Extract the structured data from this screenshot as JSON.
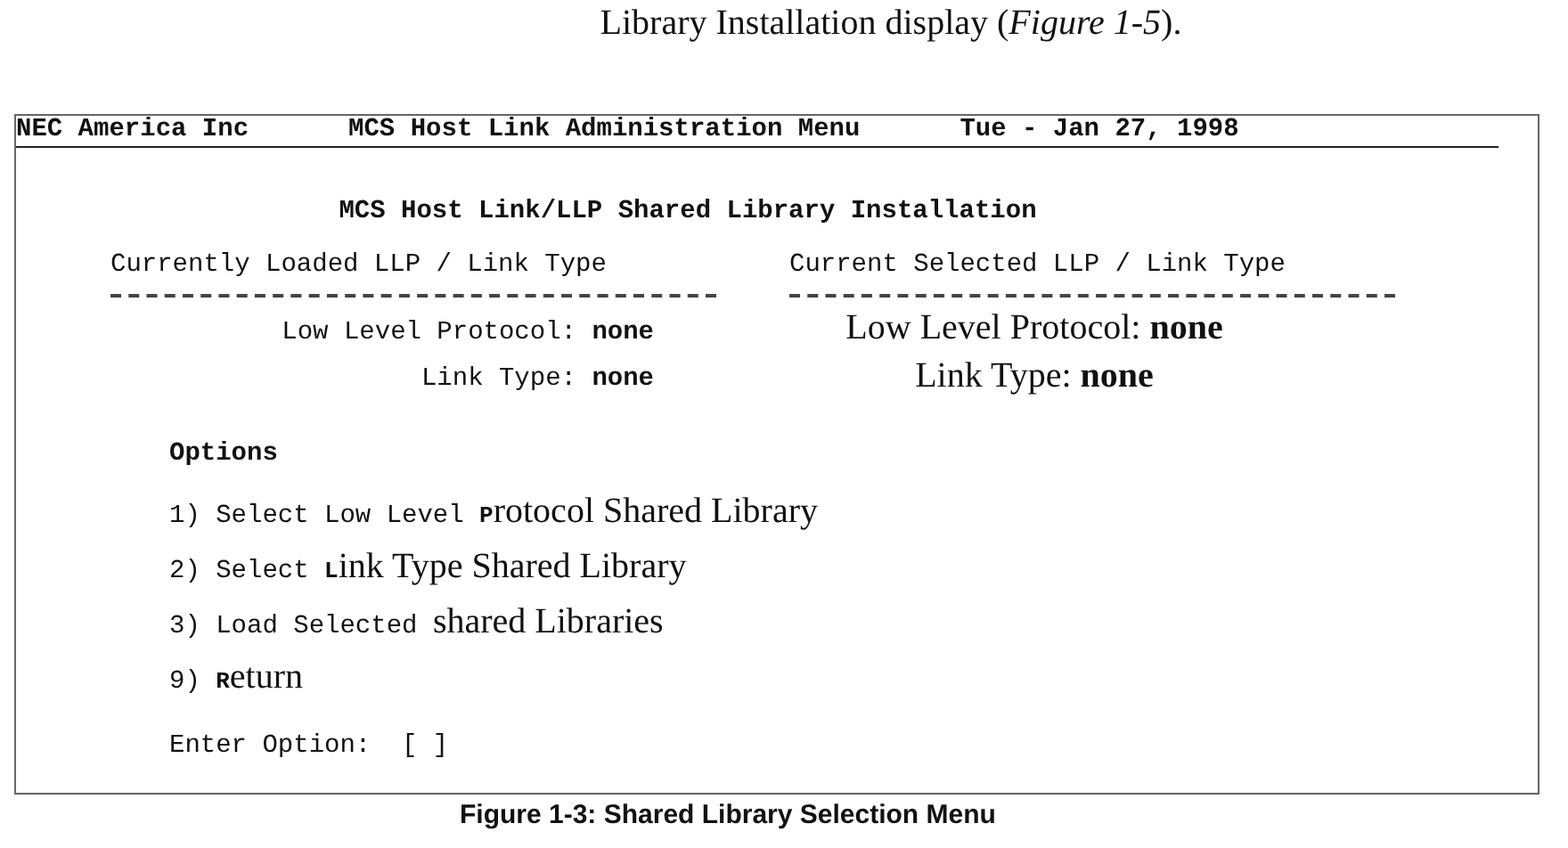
{
  "caption_top": "Library Installation display (*Figure 1-5*).",
  "terminal": {
    "header": {
      "company": "NEC America Inc",
      "menu_title": "MCS Host Link Administration Menu",
      "date": "Tue - Jan 27, 1998"
    },
    "title": "MCS Host Link/LLP Shared Library Installation",
    "columns": [
      {
        "heading": "Currently Loaded LLP / Link Type",
        "kind": "mono",
        "lines": [
          "Low Level Protocol: **none**",
          "Link Type: **none**"
        ]
      },
      {
        "heading": "Current Selected LLP / Link Type",
        "kind": "serif",
        "lines": [
          "Low Level Protocol: **none**",
          "Link Type: **none**"
        ]
      }
    ],
    "options_heading": "Options",
    "options": [
      {
        "segments": [
          {
            "kind": "mono",
            "text": "1) Select Low Level "
          },
          {
            "kind": "smallcap",
            "text": "P"
          },
          {
            "kind": "serif",
            "text": "rotocol Shared Library"
          }
        ]
      },
      {
        "segments": [
          {
            "kind": "mono",
            "text": "2) Select "
          },
          {
            "kind": "smallcap",
            "text": "L"
          },
          {
            "kind": "serif",
            "text": "ink Type Shared Library"
          }
        ]
      },
      {
        "segments": [
          {
            "kind": "mono",
            "text": "3) Load Selected "
          },
          {
            "kind": "serif",
            "text": "shared Libraries"
          }
        ]
      },
      {
        "segments": [
          {
            "kind": "mono",
            "text": "9) "
          },
          {
            "kind": "smallcap",
            "text": "R"
          },
          {
            "kind": "serif",
            "text": "eturn"
          }
        ]
      }
    ],
    "prompt": "Enter Option:  [ ]"
  },
  "caption_bottom": "Figure 1-3: Shared Library Selection Menu"
}
